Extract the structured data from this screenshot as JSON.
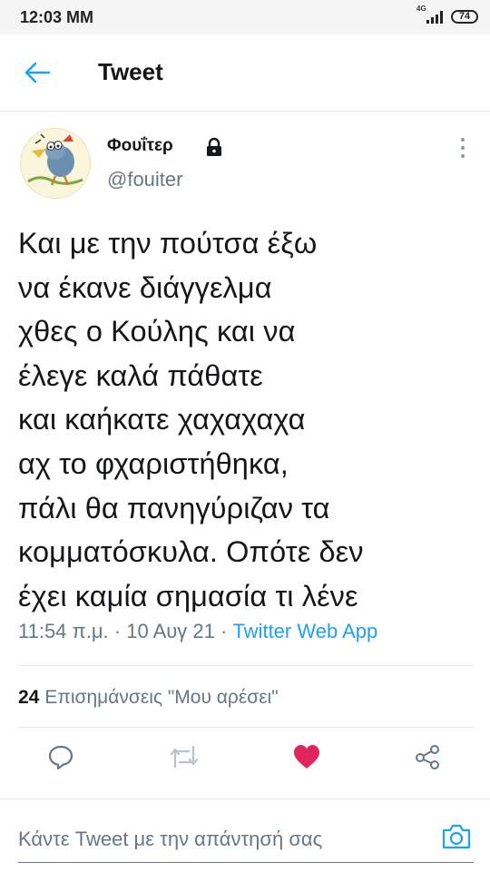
{
  "status_bar": {
    "time": "12:03 ΜΜ",
    "network": "4G",
    "battery": "74"
  },
  "header": {
    "title": "Tweet",
    "back_icon": "arrow-left-icon",
    "accent_color": "#1da1f2"
  },
  "tweet": {
    "author": {
      "display_name": "Φουΐτερ",
      "handle": "@fouiter",
      "protected_icon": "lock-icon",
      "avatar_icon": "bird-cartoon-avatar"
    },
    "text": "Και με την πούτσα έξω\nνα έκανε διάγγελμα\nχθες ο Κούλης και να\nέλεγε καλά πάθατε\nκαι καήκατε χαχαχαχα\nαχ το φχαριστήθηκα,\nπάλι θα πανηγύριζαν τα\nκομματόσκυλα. Οπότε δεν\nέχει καμία σημασία τι λένε",
    "time": "11:54 π.μ.",
    "separator": "·",
    "date": "10 Αυγ 21",
    "source": "Twitter Web App",
    "likes_count": "24",
    "likes_label": "Επισημάνσεις \"Μου αρέσει\"",
    "liked": true,
    "like_color": "#e0245e"
  },
  "actions": [
    "reply-icon",
    "retweet-icon",
    "like-icon",
    "share-icon"
  ],
  "reply_bar": {
    "placeholder": "Κάντε Tweet με την απάντησή σας",
    "camera_icon": "camera-icon"
  }
}
